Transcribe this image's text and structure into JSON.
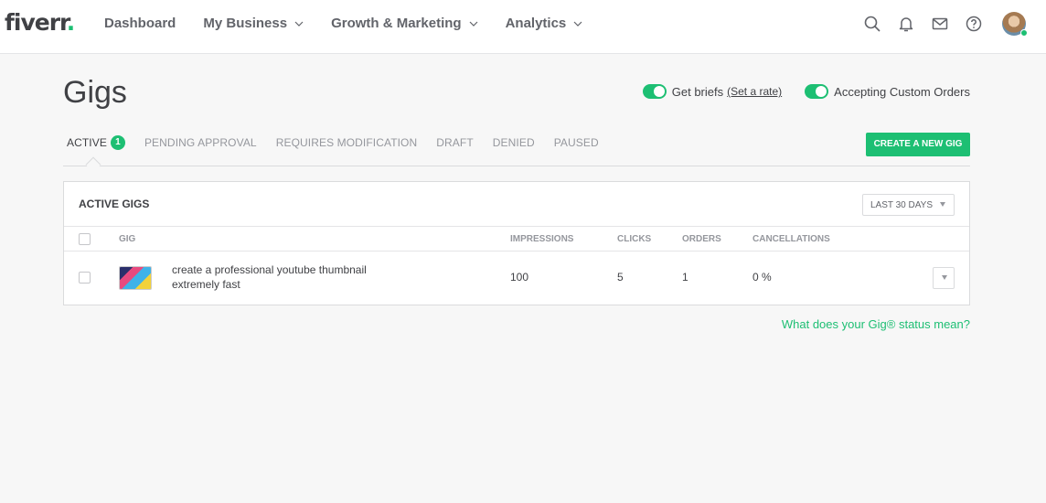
{
  "header": {
    "logo": "fiverr",
    "logo_dot": ".",
    "nav": [
      {
        "label": "Dashboard",
        "has_dropdown": false
      },
      {
        "label": "My Business",
        "has_dropdown": true
      },
      {
        "label": "Growth & Marketing",
        "has_dropdown": true
      },
      {
        "label": "Analytics",
        "has_dropdown": true
      }
    ],
    "icons": [
      "search-icon",
      "bell-icon",
      "mail-icon",
      "help-icon"
    ]
  },
  "page": {
    "title": "Gigs",
    "toggles": {
      "briefs_label": "Get briefs",
      "briefs_link": "(Set a rate)",
      "custom_orders_label": "Accepting Custom Orders"
    },
    "tabs": [
      {
        "label": "ACTIVE",
        "count": "1"
      },
      {
        "label": "PENDING APPROVAL"
      },
      {
        "label": "REQUIRES MODIFICATION"
      },
      {
        "label": "DRAFT"
      },
      {
        "label": "DENIED"
      },
      {
        "label": "PAUSED"
      }
    ],
    "create_button": "CREATE A NEW GIG"
  },
  "table": {
    "title": "ACTIVE GIGS",
    "period": "LAST 30 DAYS",
    "columns": {
      "gig": "GIG",
      "impressions": "IMPRESSIONS",
      "clicks": "CLICKS",
      "orders": "ORDERS",
      "cancellations": "CANCELLATIONS"
    },
    "rows": [
      {
        "title": "create a professional youtube thumbnail extremely fast",
        "impressions": "100",
        "clicks": "5",
        "orders": "1",
        "cancellations": "0 %"
      }
    ]
  },
  "status_link": "What does your Gig® status mean?",
  "colors": {
    "accent": "#1dbf73",
    "text": "#404145",
    "muted": "#95979d",
    "background": "#f7f7f7"
  }
}
